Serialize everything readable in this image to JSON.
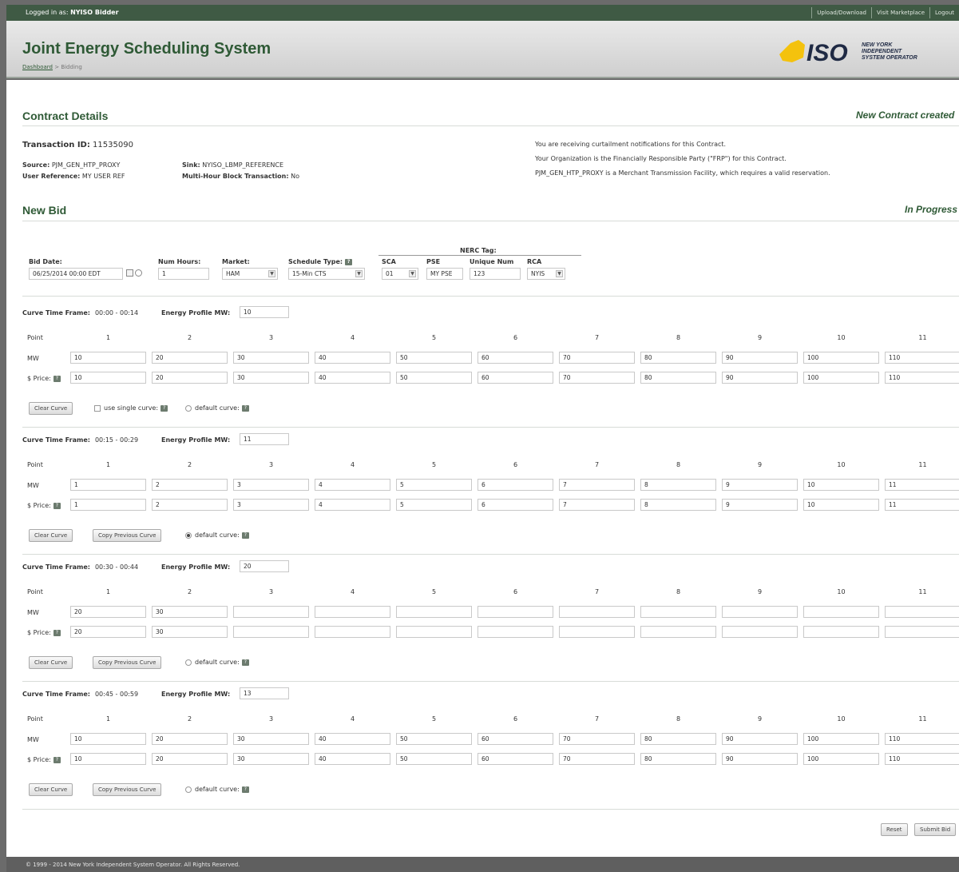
{
  "topbar": {
    "logged_in_prefix": "Logged in as:",
    "user": "NYISO Bidder",
    "links": [
      "Upload/Download",
      "Visit Marketplace",
      "Logout"
    ]
  },
  "header": {
    "title": "Joint Energy Scheduling System",
    "breadcrumb": {
      "dashboard": "Dashboard",
      "sep": " > ",
      "current": "Bidding"
    },
    "logo": {
      "mark": "ISO",
      "line1": "NEW YORK",
      "line2": "INDEPENDENT",
      "line3": "SYSTEM OPERATOR"
    }
  },
  "contract": {
    "title": "Contract Details",
    "status": "New Contract created",
    "transaction_label": "Transaction ID:",
    "transaction_id": "11535090",
    "source_label": "Source:",
    "source": "PJM_GEN_HTP_PROXY",
    "user_ref_label": "User Reference:",
    "user_ref": "MY USER REF",
    "sink_label": "Sink:",
    "sink": "NYISO_LBMP_REFERENCE",
    "multi_label": "Multi-Hour Block Transaction:",
    "multi": "No",
    "notes": [
      "You are receiving curtailment notifications for this Contract.",
      "Your Organization is the Financially Responsible Party (\"FRP\") for this Contract.",
      "PJM_GEN_HTP_PROXY is a Merchant Transmission Facility, which requires a valid reservation."
    ]
  },
  "bid": {
    "title": "New Bid",
    "status": "In Progress",
    "nerc_label": "NERC Tag:",
    "fields": {
      "bid_date_label": "Bid Date:",
      "bid_date": "06/25/2014 00:00 EDT",
      "num_hours_label": "Num Hours:",
      "num_hours": "1",
      "market_label": "Market:",
      "market": "HAM",
      "schedule_type_label": "Schedule Type:",
      "schedule_type": "15-Min CTS",
      "sca_label": "SCA",
      "sca": "01",
      "pse_label": "PSE",
      "pse": "MY PSE",
      "unique_label": "Unique Num",
      "unique": "123",
      "rca_label": "RCA",
      "rca": "NYIS"
    },
    "curve_tf_label": "Curve Time Frame:",
    "energy_label": "Energy Profile MW:",
    "point_label": "Point",
    "mw_label": "MW",
    "price_label": "$ Price:",
    "points": [
      "1",
      "2",
      "3",
      "4",
      "5",
      "6",
      "7",
      "8",
      "9",
      "10",
      "11"
    ],
    "clear_label": "Clear Curve",
    "copy_label": "Copy Previous Curve",
    "single_label": "use single curve:",
    "default_label": "default curve:",
    "reset_label": "Reset",
    "submit_label": "Submit Bid",
    "curves": [
      {
        "timeframe": "00:00 - 00:14",
        "energy": "10",
        "mw": [
          "10",
          "20",
          "30",
          "40",
          "50",
          "60",
          "70",
          "80",
          "90",
          "100",
          "110"
        ],
        "price": [
          "10",
          "20",
          "30",
          "40",
          "50",
          "60",
          "70",
          "80",
          "90",
          "100",
          "110"
        ]
      },
      {
        "timeframe": "00:15 - 00:29",
        "energy": "11",
        "mw": [
          "1",
          "2",
          "3",
          "4",
          "5",
          "6",
          "7",
          "8",
          "9",
          "10",
          "11"
        ],
        "price": [
          "1",
          "2",
          "3",
          "4",
          "5",
          "6",
          "7",
          "8",
          "9",
          "10",
          "11"
        ]
      },
      {
        "timeframe": "00:30 - 00:44",
        "energy": "20",
        "mw": [
          "20",
          "30",
          "",
          "",
          "",
          "",
          "",
          "",
          "",
          "",
          ""
        ],
        "price": [
          "20",
          "30",
          "",
          "",
          "",
          "",
          "",
          "",
          "",
          "",
          ""
        ]
      },
      {
        "timeframe": "00:45 - 00:59",
        "energy": "13",
        "mw": [
          "10",
          "20",
          "30",
          "40",
          "50",
          "60",
          "70",
          "80",
          "90",
          "100",
          "110"
        ],
        "price": [
          "10",
          "20",
          "30",
          "40",
          "50",
          "60",
          "70",
          "80",
          "90",
          "100",
          "110"
        ]
      }
    ]
  },
  "footer": {
    "text": "© 1999 - 2014 New York Independent System Operator.  All Rights Reserved."
  }
}
